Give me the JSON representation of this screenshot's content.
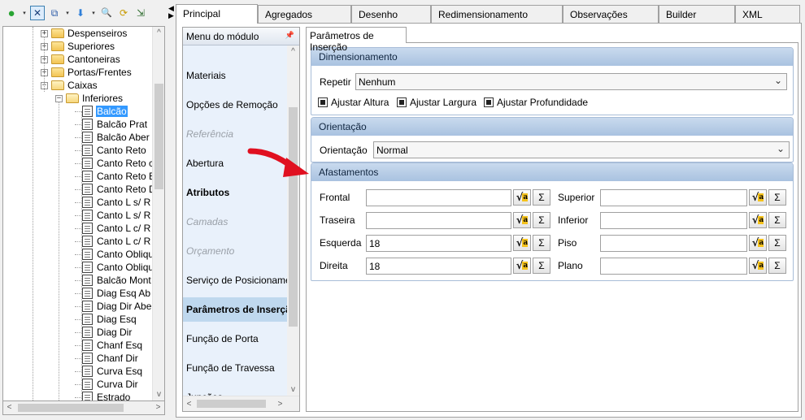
{
  "toolbar": {
    "icons": [
      "go-green-icon",
      "drop-arrow",
      "close-x-icon",
      "copy-icon",
      "drop-arrow",
      "arrow-down-blue-icon",
      "drop-arrow",
      "binoculars-icon",
      "refresh-icon",
      "tree-check-icon"
    ],
    "glyphs": {
      "go": "●",
      "drop": "▾",
      "close": "✕",
      "copy": "⧉",
      "down": "⬇",
      "find": "🔍",
      "refresh": "⟳",
      "tree": "⇲"
    }
  },
  "tree": {
    "nodes": [
      {
        "label": "Despenseiros",
        "level": 3,
        "type": "folder",
        "expander": "+"
      },
      {
        "label": "Superiores",
        "level": 3,
        "type": "folder",
        "expander": "+"
      },
      {
        "label": "Cantoneiras",
        "level": 3,
        "type": "folder",
        "expander": "+"
      },
      {
        "label": "Portas/Frentes",
        "level": 3,
        "type": "folder",
        "expander": "+"
      },
      {
        "label": "Caixas",
        "level": 3,
        "type": "folder-open",
        "expander": "−"
      },
      {
        "label": "Inferiores",
        "level": 4,
        "type": "folder-open",
        "expander": "−"
      },
      {
        "label": "Balcão",
        "level": 5,
        "type": "doc",
        "selected": true
      },
      {
        "label": "Balcão Prat",
        "level": 5,
        "type": "doc"
      },
      {
        "label": "Balcão Aber",
        "level": 5,
        "type": "doc"
      },
      {
        "label": "Canto Reto",
        "level": 5,
        "type": "doc"
      },
      {
        "label": "Canto Reto c",
        "level": 5,
        "type": "doc"
      },
      {
        "label": "Canto Reto E",
        "level": 5,
        "type": "doc"
      },
      {
        "label": "Canto Reto D",
        "level": 5,
        "type": "doc"
      },
      {
        "label": "Canto L s/ R",
        "level": 5,
        "type": "doc"
      },
      {
        "label": "Canto L s/ R",
        "level": 5,
        "type": "doc"
      },
      {
        "label": "Canto L c/ R",
        "level": 5,
        "type": "doc"
      },
      {
        "label": "Canto L c/ R",
        "level": 5,
        "type": "doc"
      },
      {
        "label": "Canto Obliqu",
        "level": 5,
        "type": "doc"
      },
      {
        "label": "Canto Obliqu",
        "level": 5,
        "type": "doc"
      },
      {
        "label": "Balcão Mont",
        "level": 5,
        "type": "doc"
      },
      {
        "label": "Diag Esq Ab",
        "level": 5,
        "type": "doc"
      },
      {
        "label": "Diag Dir Abe",
        "level": 5,
        "type": "doc"
      },
      {
        "label": "Diag Esq",
        "level": 5,
        "type": "doc"
      },
      {
        "label": "Diag Dir",
        "level": 5,
        "type": "doc"
      },
      {
        "label": "Chanf Esq",
        "level": 5,
        "type": "doc"
      },
      {
        "label": "Chanf Dir",
        "level": 5,
        "type": "doc"
      },
      {
        "label": "Curva Esq",
        "level": 5,
        "type": "doc"
      },
      {
        "label": "Curva Dir",
        "level": 5,
        "type": "doc"
      },
      {
        "label": "Estrado",
        "level": 5,
        "type": "doc"
      }
    ],
    "scroll": {
      "up": "^",
      "down": "v",
      "left": "<",
      "right": ">"
    }
  },
  "splitter": {
    "left_arrow": "◀",
    "right_arrow": "▶"
  },
  "tabs": [
    {
      "label": "Principal",
      "active": true
    },
    {
      "label": "Agregados"
    },
    {
      "label": "Desenho"
    },
    {
      "label": "Redimensionamento"
    },
    {
      "label": "Observações"
    },
    {
      "label": "Builder"
    },
    {
      "label": "XML"
    }
  ],
  "menu": {
    "title": "Menu do módulo",
    "pin_glyph": "📌",
    "items": [
      {
        "label": "Materiais"
      },
      {
        "label": "Opções de Remoção"
      },
      {
        "label": "Referência",
        "disabled": true
      },
      {
        "label": "Abertura"
      },
      {
        "label": "Atributos",
        "bold": true
      },
      {
        "label": "Camadas",
        "disabled": true
      },
      {
        "label": "Orçamento",
        "disabled": true
      },
      {
        "label": "Serviço de Posicionamen"
      },
      {
        "label": "Parâmetros de Inserção",
        "bold": true,
        "selected": true
      },
      {
        "label": "Função de Porta"
      },
      {
        "label": "Função de Travessa"
      },
      {
        "label": "Junções"
      }
    ],
    "scroll": {
      "up": "^",
      "down": "v",
      "left": "<",
      "right": ">"
    }
  },
  "panel": {
    "subtab": "Parâmetros de Inserção",
    "dimensionamento": {
      "title": "Dimensionamento",
      "repetir_label": "Repetir",
      "repetir_value": "Nenhum",
      "checkboxes": [
        "Ajustar Altura",
        "Ajustar Largura",
        "Ajustar Profundidade"
      ]
    },
    "orientacao": {
      "title": "Orientação",
      "label": "Orientação",
      "value": "Normal"
    },
    "afastamentos": {
      "title": "Afastamentos",
      "left_fields": [
        {
          "label": "Frontal",
          "value": ""
        },
        {
          "label": "Traseira",
          "value": ""
        },
        {
          "label": "Esquerda",
          "value": "18"
        },
        {
          "label": "Direita",
          "value": "18"
        }
      ],
      "right_fields": [
        {
          "label": "Superior",
          "value": ""
        },
        {
          "label": "Inferior",
          "value": ""
        },
        {
          "label": "Piso",
          "value": ""
        },
        {
          "label": "Plano",
          "value": ""
        }
      ],
      "formula_glyph": "√",
      "formula_badge": "a",
      "sum_glyph": "Σ"
    },
    "chevron": "⌄"
  },
  "colors": {
    "accent": "#3399ff",
    "group_header": "#b6cbe6",
    "menu_bg": "#e9f1fb",
    "arrow": "#e01020"
  }
}
